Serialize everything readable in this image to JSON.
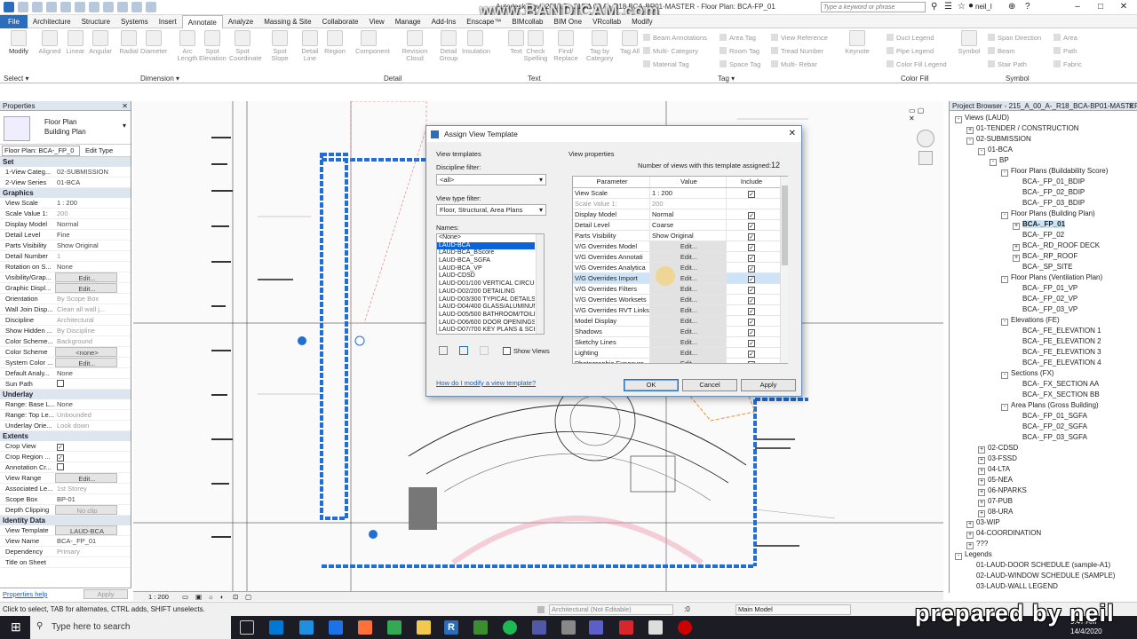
{
  "window": {
    "title": "Autodesk Revit 2018.3 - 215 A 00 A - R18 BCA-BP01-MASTER - Floor Plan: BCA-FP_01",
    "watermark": "www.BANDICAM.com",
    "search_placeholder": "Type a keyword or phrase",
    "user": "neil_l"
  },
  "ribbon": {
    "tabs": [
      "File",
      "Architecture",
      "Structure",
      "Systems",
      "Insert",
      "Annotate",
      "Analyze",
      "Massing & Site",
      "Collaborate",
      "View",
      "Manage",
      "Add-Ins",
      "Enscape™",
      "BIMcollab",
      "BIM One",
      "VRcollab",
      "Modify"
    ],
    "active_tab": "Annotate",
    "tools": [
      "Modify",
      "Aligned",
      "Linear",
      "Angular",
      "Radial",
      "Diameter",
      "Arc Length",
      "Spot Elevation",
      "Spot Coordinate",
      "Spot Slope",
      "Detail Line",
      "Region",
      "Component",
      "Revision Cloud",
      "Detail Group",
      "Insulation",
      "Text",
      "Check Spelling",
      "Find/ Replace",
      "Tag by Category",
      "Tag All",
      "Keynote",
      "Symbol"
    ],
    "small_tools": [
      "Beam Annotations",
      "Multi- Category",
      "Material Tag",
      "Area Tag",
      "Room Tag",
      "Space Tag",
      "View Reference",
      "Tread Number",
      "Multi- Rebar",
      "Duct Legend",
      "Pipe Legend",
      "Color Fill Legend",
      "Span Direction",
      "Beam",
      "Stair Path",
      "Area",
      "Path",
      "Fabric"
    ],
    "groups": [
      "Select ▾",
      "Dimension ▾",
      "Detail",
      "Text",
      "Tag ▾",
      "Color Fill",
      "Symbol"
    ]
  },
  "properties": {
    "title": "Properties",
    "type_name": "Floor Plan",
    "type_sub": "Building Plan",
    "selector": "Floor Plan: BCA-_FP_0",
    "edit_type": "Edit Type",
    "help": "Properties help",
    "apply": "Apply",
    "sections": [
      {
        "name": "Set",
        "rows": [
          [
            "1-View Categ...",
            "02-SUBMISSION"
          ],
          [
            "2-View Series",
            "01-BCA"
          ]
        ]
      },
      {
        "name": "Graphics",
        "rows": [
          [
            "View Scale",
            "1 : 200"
          ],
          [
            "Scale Value   1:",
            "200"
          ],
          [
            "Display Model",
            "Normal"
          ],
          [
            "Detail Level",
            "Fine"
          ],
          [
            "Parts Visibility",
            "Show Original"
          ],
          [
            "Detail Number",
            "1"
          ],
          [
            "Rotation on S...",
            "None"
          ],
          [
            "Visibility/Grap...",
            "Edit..."
          ],
          [
            "Graphic Displ...",
            "Edit..."
          ],
          [
            "Orientation",
            "By Scope Box"
          ],
          [
            "Wall Join Disp...",
            "Clean all wall j..."
          ],
          [
            "Discipline",
            "Architectural"
          ],
          [
            "Show Hidden ...",
            "By Discipline"
          ],
          [
            "Color Scheme...",
            "Background"
          ],
          [
            "Color Scheme",
            "<none>"
          ],
          [
            "System Color ...",
            "Edit..."
          ],
          [
            "Default Analy...",
            "None"
          ],
          [
            "Sun Path",
            ""
          ]
        ]
      },
      {
        "name": "Underlay",
        "rows": [
          [
            "Range: Base L...",
            "None"
          ],
          [
            "Range: Top Le...",
            "Unbounded"
          ],
          [
            "Underlay Orie...",
            "Look down"
          ]
        ]
      },
      {
        "name": "Extents",
        "rows": [
          [
            "Crop View",
            ""
          ],
          [
            "Crop Region ...",
            ""
          ],
          [
            "Annotation Cr...",
            ""
          ],
          [
            "View Range",
            "Edit..."
          ],
          [
            "Associated Le...",
            "1st Storey"
          ],
          [
            "Scope Box",
            "BP-01"
          ],
          [
            "Depth Clipping",
            "No clip"
          ]
        ]
      },
      {
        "name": "Identity Data",
        "rows": [
          [
            "View Template",
            "LAUD-BCA"
          ],
          [
            "View Name",
            "BCA-_FP_01"
          ],
          [
            "Dependency",
            "Primary"
          ],
          [
            "Title on Sheet",
            ""
          ]
        ]
      }
    ]
  },
  "project_browser": {
    "title": "Project Browser - 215_A_00_A-_R18_BCA-BP01-MASTER...",
    "nodes": [
      {
        "d": 0,
        "t": "-",
        "l": "Views (LAUD)"
      },
      {
        "d": 1,
        "t": "+",
        "l": "01-TENDER / CONSTRUCTION"
      },
      {
        "d": 1,
        "t": "-",
        "l": "02-SUBMISSION"
      },
      {
        "d": 2,
        "t": "-",
        "l": "01-BCA"
      },
      {
        "d": 3,
        "t": "-",
        "l": "BP"
      },
      {
        "d": 4,
        "t": "-",
        "l": "Floor Plans (Buildability Score)"
      },
      {
        "d": 5,
        "t": "",
        "l": "BCA-_FP_01_BDIP"
      },
      {
        "d": 5,
        "t": "",
        "l": "BCA-_FP_02_BDIP"
      },
      {
        "d": 5,
        "t": "",
        "l": "BCA-_FP_03_BDIP"
      },
      {
        "d": 4,
        "t": "-",
        "l": "Floor Plans (Building Plan)"
      },
      {
        "d": 5,
        "t": "+",
        "l": "BCA-_FP_01",
        "sel": true
      },
      {
        "d": 5,
        "t": "",
        "l": "BCA-_FP_02"
      },
      {
        "d": 5,
        "t": "+",
        "l": "BCA-_RD_ROOF DECK"
      },
      {
        "d": 5,
        "t": "+",
        "l": "BCA-_RP_ROOF"
      },
      {
        "d": 5,
        "t": "",
        "l": "BCA-_SP_SITE"
      },
      {
        "d": 4,
        "t": "-",
        "l": "Floor Plans (Ventilation Plan)"
      },
      {
        "d": 5,
        "t": "",
        "l": "BCA-_FP_01_VP"
      },
      {
        "d": 5,
        "t": "",
        "l": "BCA-_FP_02_VP"
      },
      {
        "d": 5,
        "t": "",
        "l": "BCA-_FP_03_VP"
      },
      {
        "d": 4,
        "t": "-",
        "l": "Elevations (FE)"
      },
      {
        "d": 5,
        "t": "",
        "l": "BCA-_FE_ELEVATION 1"
      },
      {
        "d": 5,
        "t": "",
        "l": "BCA-_FE_ELEVATION 2"
      },
      {
        "d": 5,
        "t": "",
        "l": "BCA-_FE_ELEVATION 3"
      },
      {
        "d": 5,
        "t": "",
        "l": "BCA-_FE_ELEVATION 4"
      },
      {
        "d": 4,
        "t": "-",
        "l": "Sections (FX)"
      },
      {
        "d": 5,
        "t": "",
        "l": "BCA-_FX_SECTION AA"
      },
      {
        "d": 5,
        "t": "",
        "l": "BCA-_FX_SECTION BB"
      },
      {
        "d": 4,
        "t": "-",
        "l": "Area Plans (Gross Building)"
      },
      {
        "d": 5,
        "t": "",
        "l": "BCA-_FP_01_SGFA"
      },
      {
        "d": 5,
        "t": "",
        "l": "BCA-_FP_02_SGFA"
      },
      {
        "d": 5,
        "t": "",
        "l": "BCA-_FP_03_SGFA"
      },
      {
        "d": 2,
        "t": "+",
        "l": "02-CDSD"
      },
      {
        "d": 2,
        "t": "+",
        "l": "03-FSSD"
      },
      {
        "d": 2,
        "t": "+",
        "l": "04-LTA"
      },
      {
        "d": 2,
        "t": "+",
        "l": "05-NEA"
      },
      {
        "d": 2,
        "t": "+",
        "l": "06-NPARKS"
      },
      {
        "d": 2,
        "t": "+",
        "l": "07-PUB"
      },
      {
        "d": 2,
        "t": "+",
        "l": "08-URA"
      },
      {
        "d": 1,
        "t": "+",
        "l": "03-WIP"
      },
      {
        "d": 1,
        "t": "+",
        "l": "04-COORDINATION"
      },
      {
        "d": 1,
        "t": "+",
        "l": "???"
      },
      {
        "d": 0,
        "t": "-",
        "l": "Legends"
      },
      {
        "d": 1,
        "t": "",
        "l": "01-LAUD-DOOR SCHEDULE (sample-A1)"
      },
      {
        "d": 1,
        "t": "",
        "l": "02-LAUD-WINDOW SCHEDULE (SAMPLE)"
      },
      {
        "d": 1,
        "t": "",
        "l": "03-LAUD-WALL LEGEND"
      }
    ]
  },
  "dialog": {
    "title": "Assign View Template",
    "view_templates_label": "View templates",
    "discipline_label": "Discipline filter:",
    "discipline_value": "<all>",
    "view_type_label": "View type filter:",
    "view_type_value": "Floor, Structural, Area Plans",
    "names_label": "Names:",
    "names": [
      "<None>",
      "LAUD-BCA",
      "LAUD-BCA_BScore",
      "LAUD-BCA_SGFA",
      "LAUD-BCA_VP",
      "LAUD-CDSD",
      "LAUD-D01/100 VERTICAL CIRCUL",
      "LAUD-D02/200 DETAILING",
      "LAUD-D03/300 TYPICAL DETAILS",
      "LAUD-D04/400 GLASS/ALUMINUM",
      "LAUD-D05/500 BATHROOM/TOILE",
      "LAUD-D06/600 DOOR OPENINGS",
      "LAUD-D07/700 KEY PLANS & SCHE"
    ],
    "selected_name": "LAUD-BCA",
    "show_views": "Show Views",
    "help_link": "How do I modify a view template?",
    "view_properties_label": "View properties",
    "views_assigned_label": "Number of views with this template assigned:",
    "views_assigned_count": "12",
    "columns": [
      "Parameter",
      "Value",
      "Include"
    ],
    "rows": [
      {
        "p": "View Scale",
        "v": "1 : 200",
        "e": false
      },
      {
        "p": "Scale Value   1:",
        "v": "200",
        "e": false,
        "dim": true
      },
      {
        "p": "Display Model",
        "v": "Normal",
        "e": false
      },
      {
        "p": "Detail Level",
        "v": "Coarse",
        "e": false
      },
      {
        "p": "Parts Visibility",
        "v": "Show Original",
        "e": false
      },
      {
        "p": "V/G Overrides Model",
        "v": "Edit...",
        "e": true
      },
      {
        "p": "V/G Overrides Annotati",
        "v": "Edit...",
        "e": true
      },
      {
        "p": "V/G Overrides Analytica",
        "v": "Edit...",
        "e": true
      },
      {
        "p": "V/G Overrides Import",
        "v": "Edit...",
        "e": true
      },
      {
        "p": "V/G Overrides Filters",
        "v": "Edit...",
        "e": true
      },
      {
        "p": "V/G Overrides Worksets",
        "v": "Edit...",
        "e": true
      },
      {
        "p": "V/G Overrides RVT Links",
        "v": "Edit...",
        "e": true
      },
      {
        "p": "Model Display",
        "v": "Edit...",
        "e": true
      },
      {
        "p": "Shadows",
        "v": "Edit...",
        "e": true
      },
      {
        "p": "Sketchy Lines",
        "v": "Edit...",
        "e": true
      },
      {
        "p": "Lighting",
        "v": "Edit...",
        "e": true
      },
      {
        "p": "Photographic Exposure",
        "v": "Edit...",
        "e": true
      }
    ],
    "ok": "OK",
    "cancel": "Cancel",
    "apply": "Apply"
  },
  "view_control": {
    "scale": "1 : 200"
  },
  "status": {
    "hint": "Click to select, TAB for alternates, CTRL adds, SHIFT unselects.",
    "workset": "Architectural (Not Editable)",
    "coord": ":0",
    "model": "Main Model"
  },
  "taskbar": {
    "search": "Type here to search",
    "time": "9:47 AM",
    "date": "14/4/2020"
  },
  "overlay": {
    "prepared_by": "prepared by neil"
  },
  "colors": {
    "accent": "#2a6ebb",
    "selection": "#0a64d8",
    "taskbar": "#1c1c24"
  }
}
